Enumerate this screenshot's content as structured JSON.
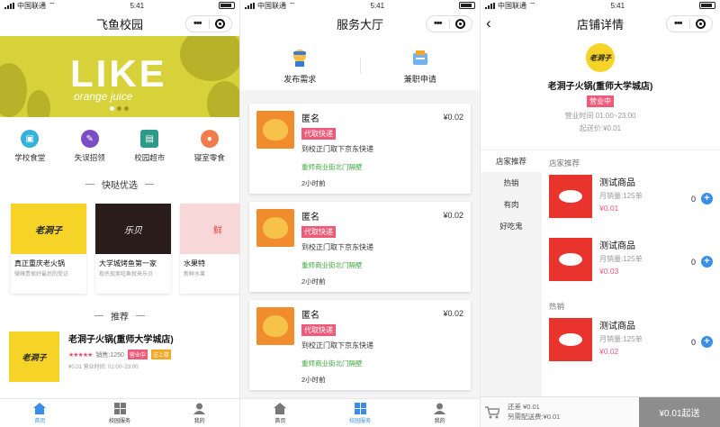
{
  "colors": {
    "accent": "#3a8ee8",
    "pink": "#f05a79",
    "green": "#3ca83c",
    "banner": "#d8d23a",
    "cart_button": "#8d8d8d"
  },
  "status_bar": {
    "carrier": "中国联通",
    "time": "5:41"
  },
  "home": {
    "title": "飞鱼校园",
    "banner": {
      "headline": "LIKE",
      "sub": "orange juice"
    },
    "categories": [
      {
        "label": "学校食堂",
        "icon": "canteen-icon",
        "color": "#35b2d9"
      },
      {
        "label": "失误招领",
        "icon": "lost-found-icon",
        "color": "#7a4cc6"
      },
      {
        "label": "校园超市",
        "icon": "supermarket-icon",
        "color": "#2e9a8a"
      },
      {
        "label": "寝室零食",
        "icon": "snack-icon",
        "color": "#f07c4e"
      }
    ],
    "featured_title": "快哒优选",
    "shops": [
      {
        "name": "真正重庆老火锅",
        "desc": "微辣贵很好最后的受访",
        "logo": "老洞子",
        "bg": "#f5d327"
      },
      {
        "name": "大学城烤鱼第一家",
        "desc": "现杀现卖吃鱼就来乐贝",
        "logo": "乐贝",
        "bg": "#2b1c1c"
      },
      {
        "name": "水果特",
        "desc": "新鲜水果",
        "logo": "鲜",
        "bg": "#f7d7d7"
      }
    ],
    "recommend_title": "推荐",
    "recommend": {
      "name": "老洞子火锅(重师大学城店)",
      "sales": "销售:1250",
      "status": "营业中",
      "delivery": "送上楼",
      "hours_line": "¥0.01  营业时间: 01:00~23:00",
      "logo": "老洞子"
    },
    "tabs": [
      {
        "label": "首页",
        "icon": "home-icon"
      },
      {
        "label": "校园服务",
        "icon": "grid-icon"
      },
      {
        "label": "我的",
        "icon": "user-icon"
      }
    ]
  },
  "service": {
    "title": "服务大厅",
    "actions": [
      {
        "label": "发布需求",
        "icon": "publish-icon"
      },
      {
        "label": "兼职申请",
        "icon": "parttime-icon"
      }
    ],
    "cards": [
      {
        "name": "匿名",
        "badge": "代取快递",
        "desc": "到校正门取下京东快递",
        "addr": "重师商业街北门隔壁",
        "time": "2小时前",
        "price": "¥0.02"
      },
      {
        "name": "匿名",
        "badge": "代取快递",
        "desc": "到校正门取下京东快递",
        "addr": "重师商业街北门隔壁",
        "time": "2小时前",
        "price": "¥0.02"
      },
      {
        "name": "匿名",
        "badge": "代取快递",
        "desc": "到校正门取下京东快递",
        "addr": "重师商业街北门隔壁",
        "time": "2小时前",
        "price": "¥0.02"
      }
    ]
  },
  "detail": {
    "title": "店铺详情",
    "shop_name": "老洞子火锅(重师大学城店)",
    "logo": "老洞子",
    "status": "营业中",
    "hours": "营业时间 01:00~23:00",
    "min_price": "起送价:¥0.01",
    "sidebar": [
      "店家推荐",
      "热销",
      "有肉",
      "好吃鬼"
    ],
    "groups": [
      {
        "title": "店家推荐",
        "items": [
          {
            "name": "测试商品",
            "sales": "月销量:125单",
            "price": "¥0.01",
            "qty": "0"
          },
          {
            "name": "测试商品",
            "sales": "月销量:125单",
            "price": "¥0.03",
            "qty": "0"
          }
        ]
      },
      {
        "title": "热销",
        "items": [
          {
            "name": "测试商品",
            "sales": "月销量:125单",
            "price": "¥0.02",
            "qty": "0"
          }
        ]
      }
    ],
    "cart": {
      "remaining": "还差 ¥0.01",
      "delivery_fee": "另需配送费:¥0.01",
      "button": "¥0.01起送"
    }
  }
}
